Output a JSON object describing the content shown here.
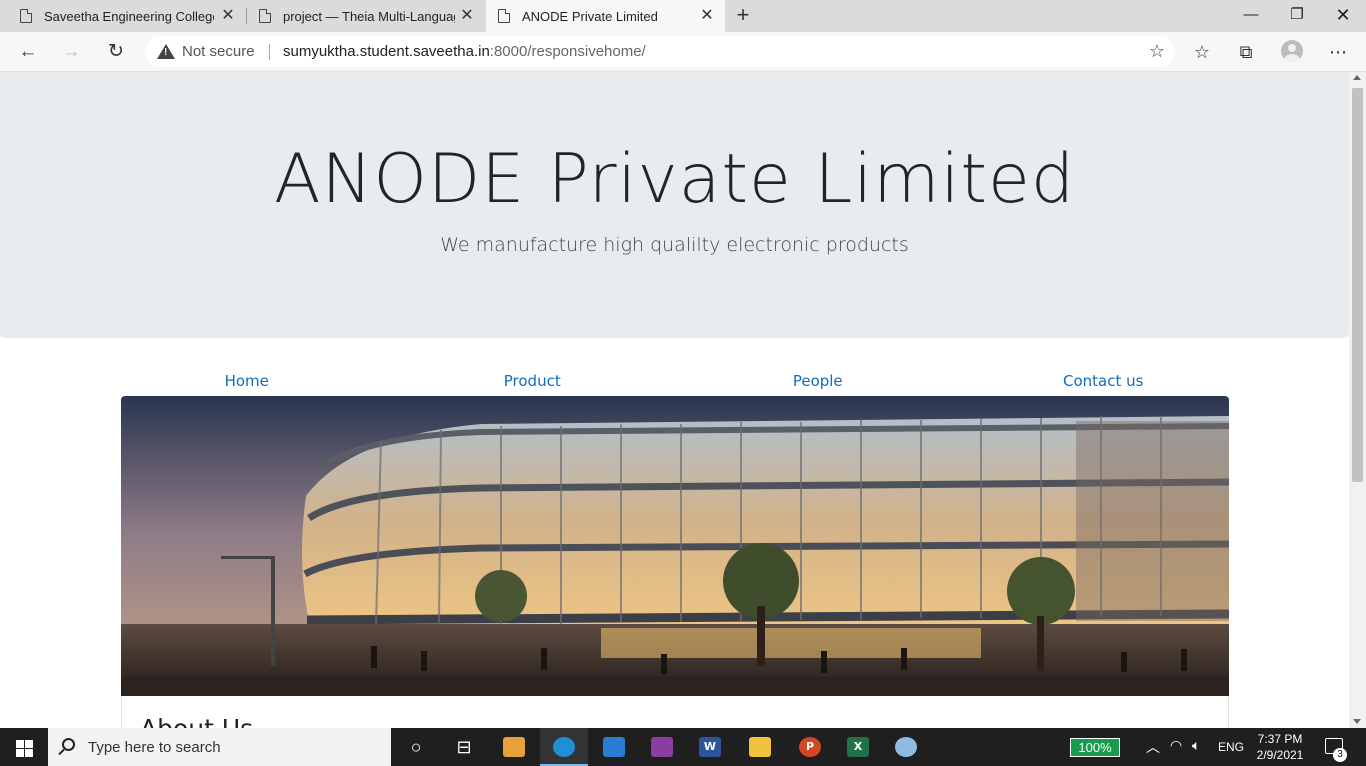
{
  "browser": {
    "tabs": [
      {
        "title": "Saveetha Engineering College",
        "active": false
      },
      {
        "title": "project — Theia Multi-Language",
        "active": false
      },
      {
        "title": "ANODE Private Limited",
        "active": true
      }
    ],
    "new_tab_label": "+",
    "security_label": "Not secure",
    "url_host": "sumyuktha.student.saveetha.in",
    "url_rest": ":8000/responsivehome/"
  },
  "page": {
    "jumbotron": {
      "title": "ANODE Private Limited",
      "lead": "We manufacture high qualilty electronic products"
    },
    "nav": [
      {
        "label": "Home"
      },
      {
        "label": "Product"
      },
      {
        "label": "People"
      },
      {
        "label": "Contact us"
      }
    ],
    "about_title": "About Us"
  },
  "taskbar": {
    "search_placeholder": "Type here to search",
    "battery": "100%",
    "language": "ENG",
    "time": "7:37 PM",
    "date": "2/9/2021",
    "notification_count": "3"
  },
  "colors": {
    "link": "#0d6ebd",
    "jumbotron_bg": "#e9ecef",
    "battery_green": "#169c4c"
  }
}
